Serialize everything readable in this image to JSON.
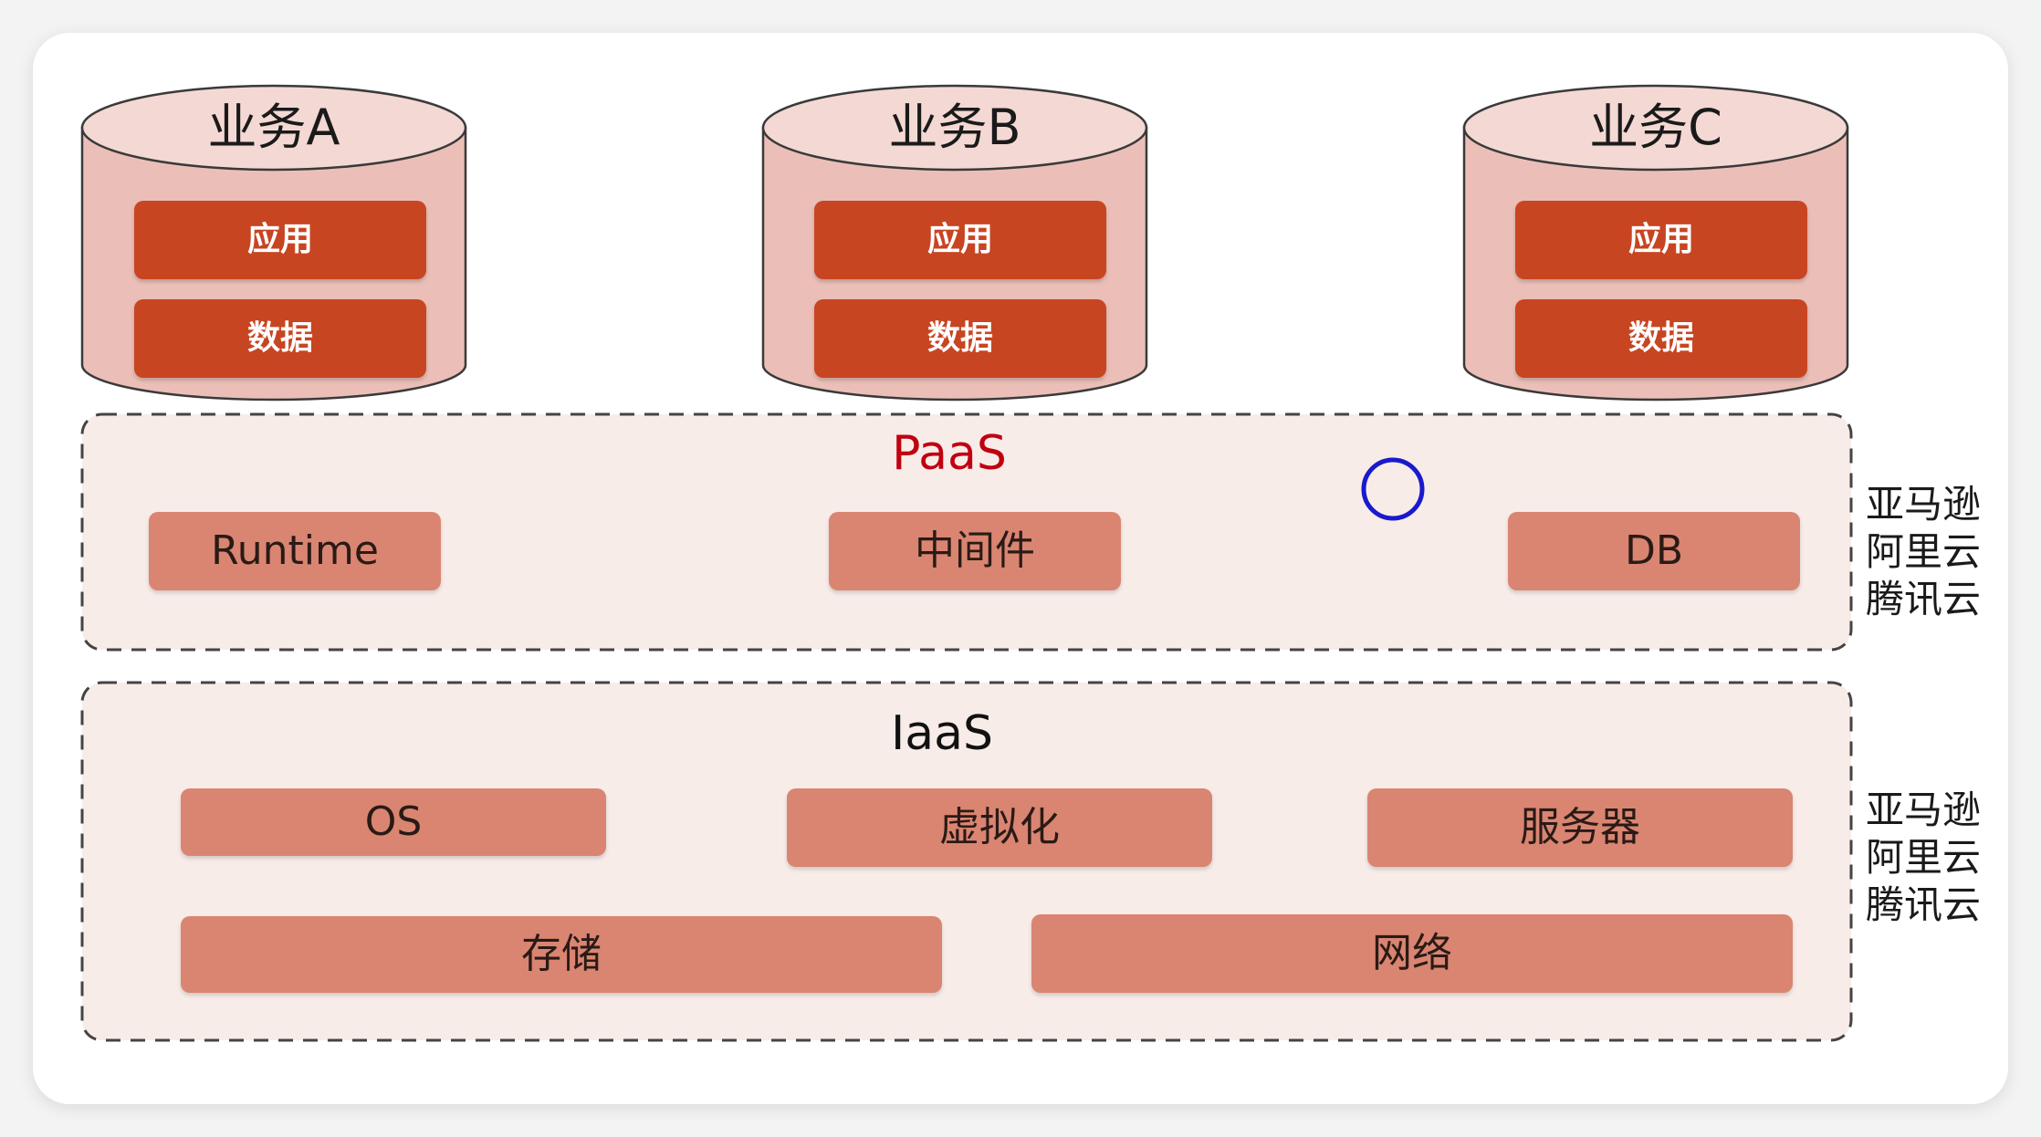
{
  "businesses": [
    {
      "title": "业务A",
      "app_label": "应用",
      "data_label": "数据"
    },
    {
      "title": "业务B",
      "app_label": "应用",
      "data_label": "数据"
    },
    {
      "title": "业务C",
      "app_label": "应用",
      "data_label": "数据"
    }
  ],
  "paas": {
    "title": "PaaS",
    "title_color": "#c00010",
    "items": [
      "Runtime",
      "中间件",
      "DB"
    ],
    "vendors": [
      "亚马逊",
      "阿里云",
      "腾讯云"
    ]
  },
  "iaas": {
    "title": "IaaS",
    "items_row1": [
      "OS",
      "虚拟化",
      "服务器"
    ],
    "items_row2": [
      "存储",
      "网络"
    ],
    "vendors": [
      "亚马逊",
      "阿里云",
      "腾讯云"
    ]
  },
  "colors": {
    "cylinder_body": "#ebbfb7",
    "cylinder_top": "#f4d8d3",
    "app_box": "#c84522",
    "component_box": "#d98571",
    "layer_fill": "#f8ece9",
    "cursor_ring": "#1a1acc"
  }
}
